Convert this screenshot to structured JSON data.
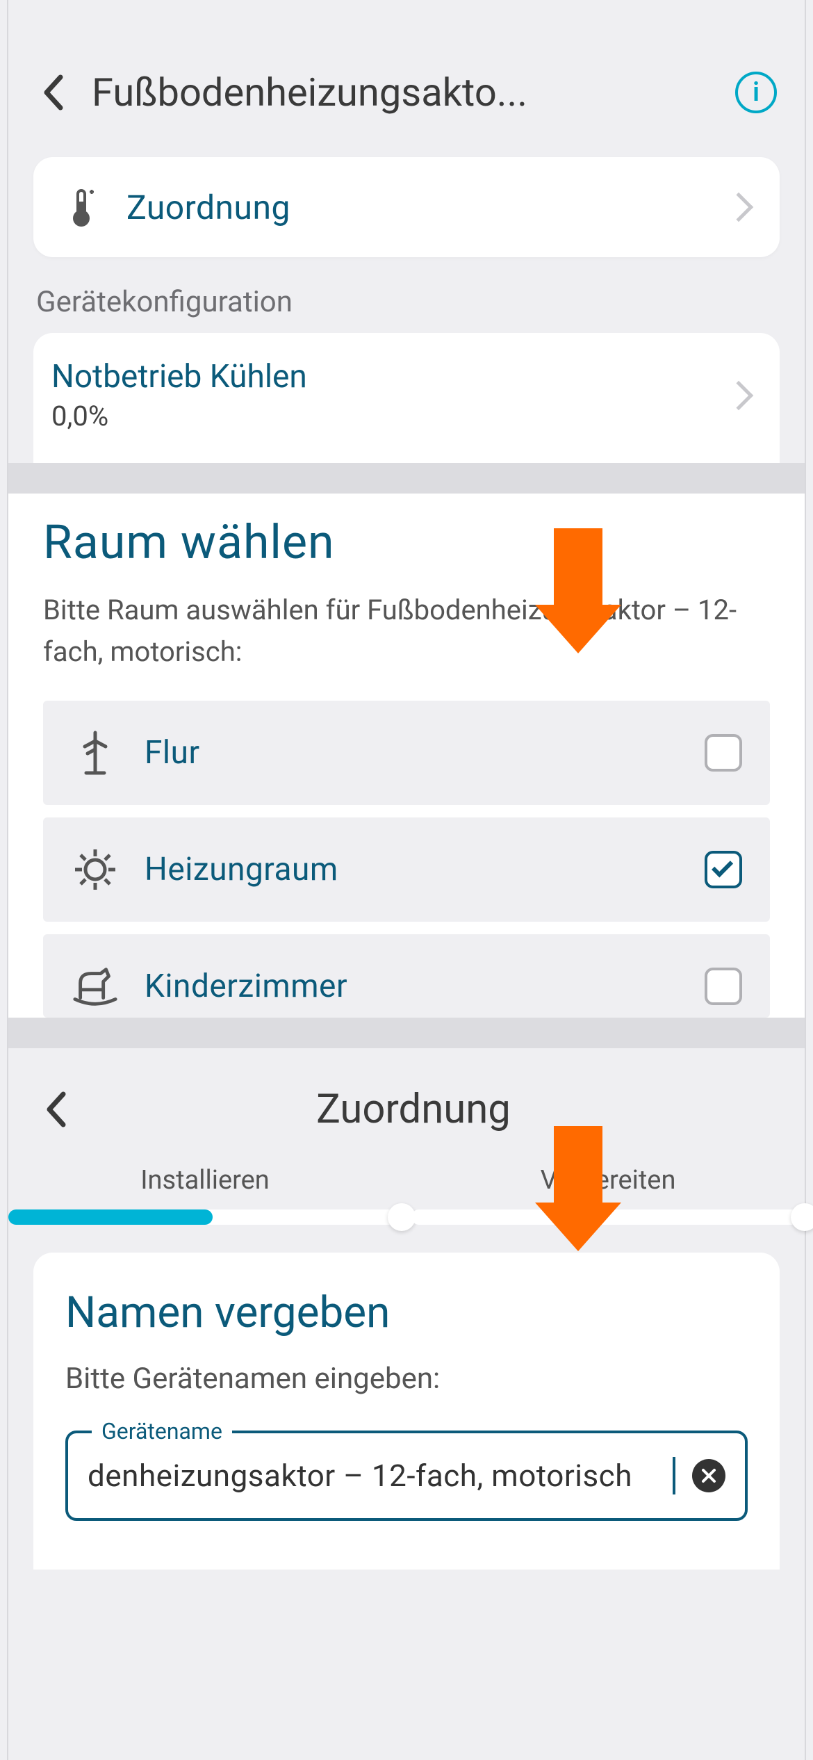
{
  "header": {
    "title": "Fußbodenheizungsakto...",
    "info_label": "i"
  },
  "assignment_row": {
    "label": "Zuordnung"
  },
  "config_section": {
    "caption": "Gerätekonfiguration",
    "item_title": "Notbetrieb Kühlen",
    "item_value": "0,0%"
  },
  "room_select": {
    "title": "Raum wählen",
    "subtitle": "Bitte Raum auswählen für Fußbodenheizungsaktor – 12-fach, motorisch:",
    "rooms": [
      {
        "label": "Flur",
        "checked": false
      },
      {
        "label": "Heizungraum",
        "checked": true
      },
      {
        "label": "Kinderzimmer",
        "checked": false
      }
    ]
  },
  "assign_panel": {
    "title": "Zuordnung",
    "steps": [
      {
        "label": "Installieren",
        "progress": 0.52
      },
      {
        "label": "Vorbereiten",
        "progress": 0.0
      }
    ],
    "form_title": "Namen vergeben",
    "form_subtitle": "Bitte Gerätenamen eingeben:",
    "field_legend": "Gerätename",
    "field_value": "denheizungsaktor – 12-fach, motorisch"
  }
}
